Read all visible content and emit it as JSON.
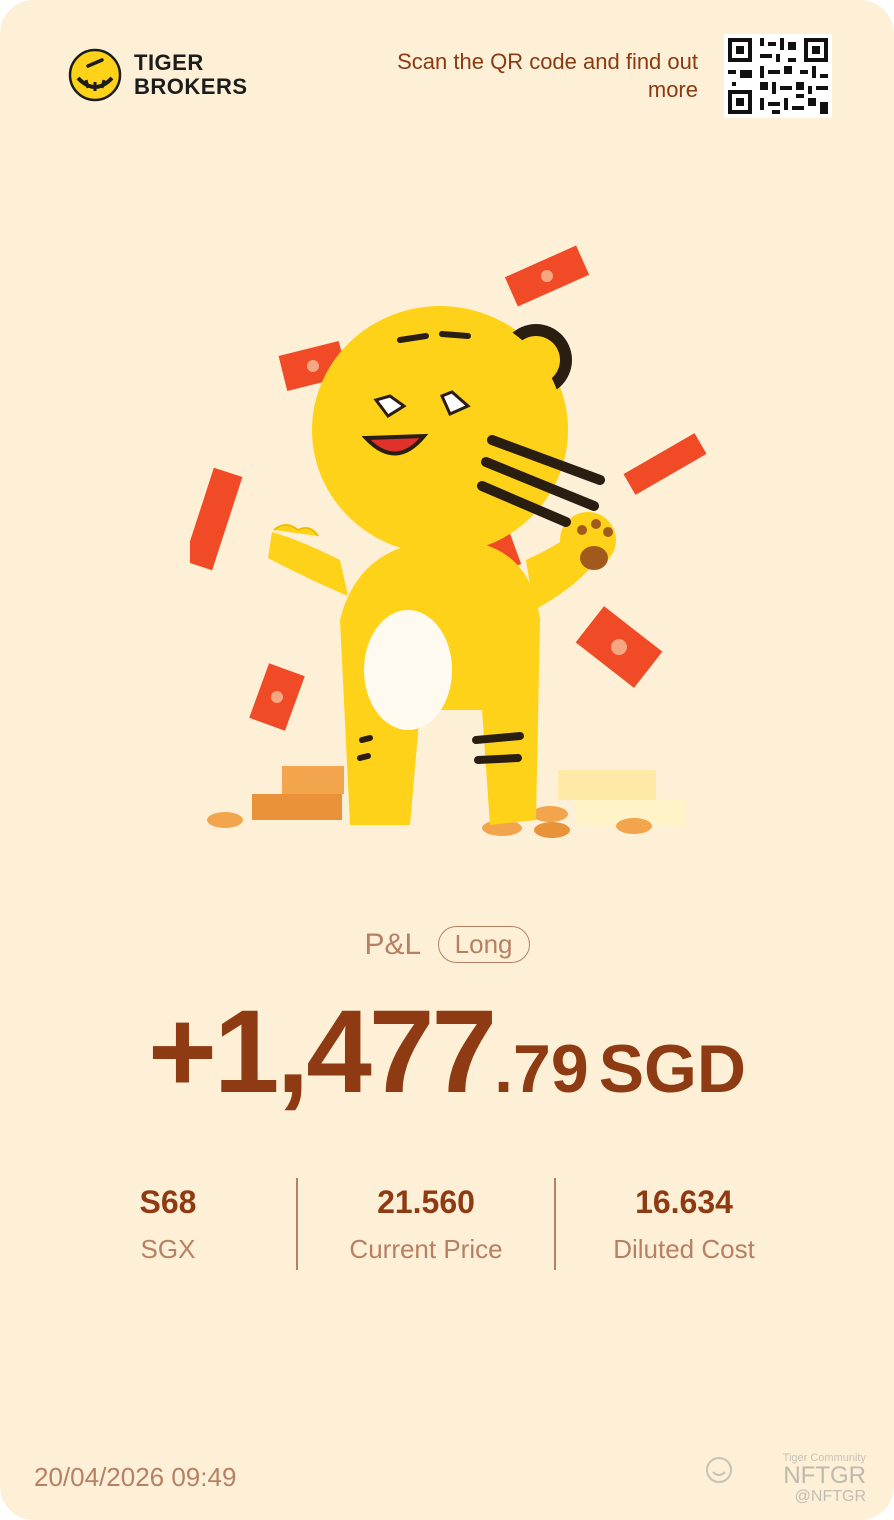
{
  "brand": {
    "line1": "TIGER",
    "line2": "BROKERS"
  },
  "header": {
    "scan_text": "Scan the QR code and find out more"
  },
  "pnl": {
    "label": "P&L",
    "side_badge": "Long",
    "sign_int": "+1,477",
    "decimal": ".79",
    "currency": "SGD"
  },
  "stats": [
    {
      "value": "S68",
      "label": "SGX"
    },
    {
      "value": "21.560",
      "label": "Current Price"
    },
    {
      "value": "16.634",
      "label": "Diluted Cost"
    }
  ],
  "footer": {
    "timestamp": "20/04/2026 09:49"
  },
  "watermark": {
    "community": "Tiger Community",
    "name": "NFTGR",
    "handle": "@NFTGR"
  },
  "colors": {
    "background": "#fdf0d6",
    "accent": "#8e3a12",
    "muted": "#b78064",
    "tiger_yellow": "#ffd21a"
  },
  "icons": {
    "logo": "tiger-logo-icon",
    "qr": "qr-code-icon",
    "mascot": "tiger-mascot-illustration"
  }
}
